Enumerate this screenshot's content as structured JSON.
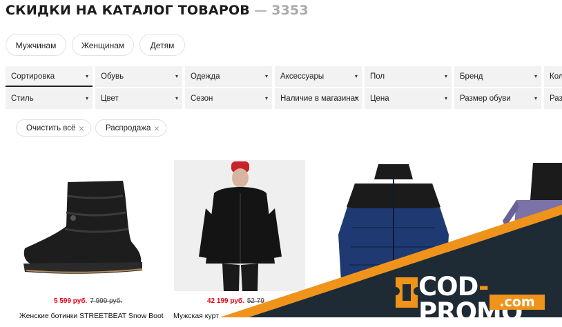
{
  "header": {
    "title": "СКИДКИ НА КАТАЛОГ ТОВАРОВ",
    "count": "3353"
  },
  "segments": [
    "Мужчинам",
    "Женщинам",
    "Детям"
  ],
  "filters_row1": [
    "Сортировка",
    "Обувь",
    "Одежда",
    "Аксессуары",
    "Пол",
    "Бренд",
    "Колл"
  ],
  "filters_row2": [
    "Стиль",
    "Цвет",
    "Сезон",
    "Наличие в магазинах",
    "Цена",
    "Размер обуви",
    "Разм"
  ],
  "active_chips": [
    "Очистить всё",
    "Распродажа"
  ],
  "products": [
    {
      "price": "5 599 руб.",
      "old_price": "7 999 руб.",
      "name": "Женские ботинки STREETBEAT Snow Boot"
    },
    {
      "price": "42 199 руб.",
      "old_price": "52 79",
      "name": "Мужская курт"
    }
  ],
  "promo": {
    "brand_left": "COD",
    "brand_dash": "-",
    "brand_right": "PROMO",
    "domain": ".com"
  },
  "colors": {
    "sale_red": "#e30613",
    "promo_orange": "#f0931b",
    "promo_dark": "#1f2b34"
  }
}
